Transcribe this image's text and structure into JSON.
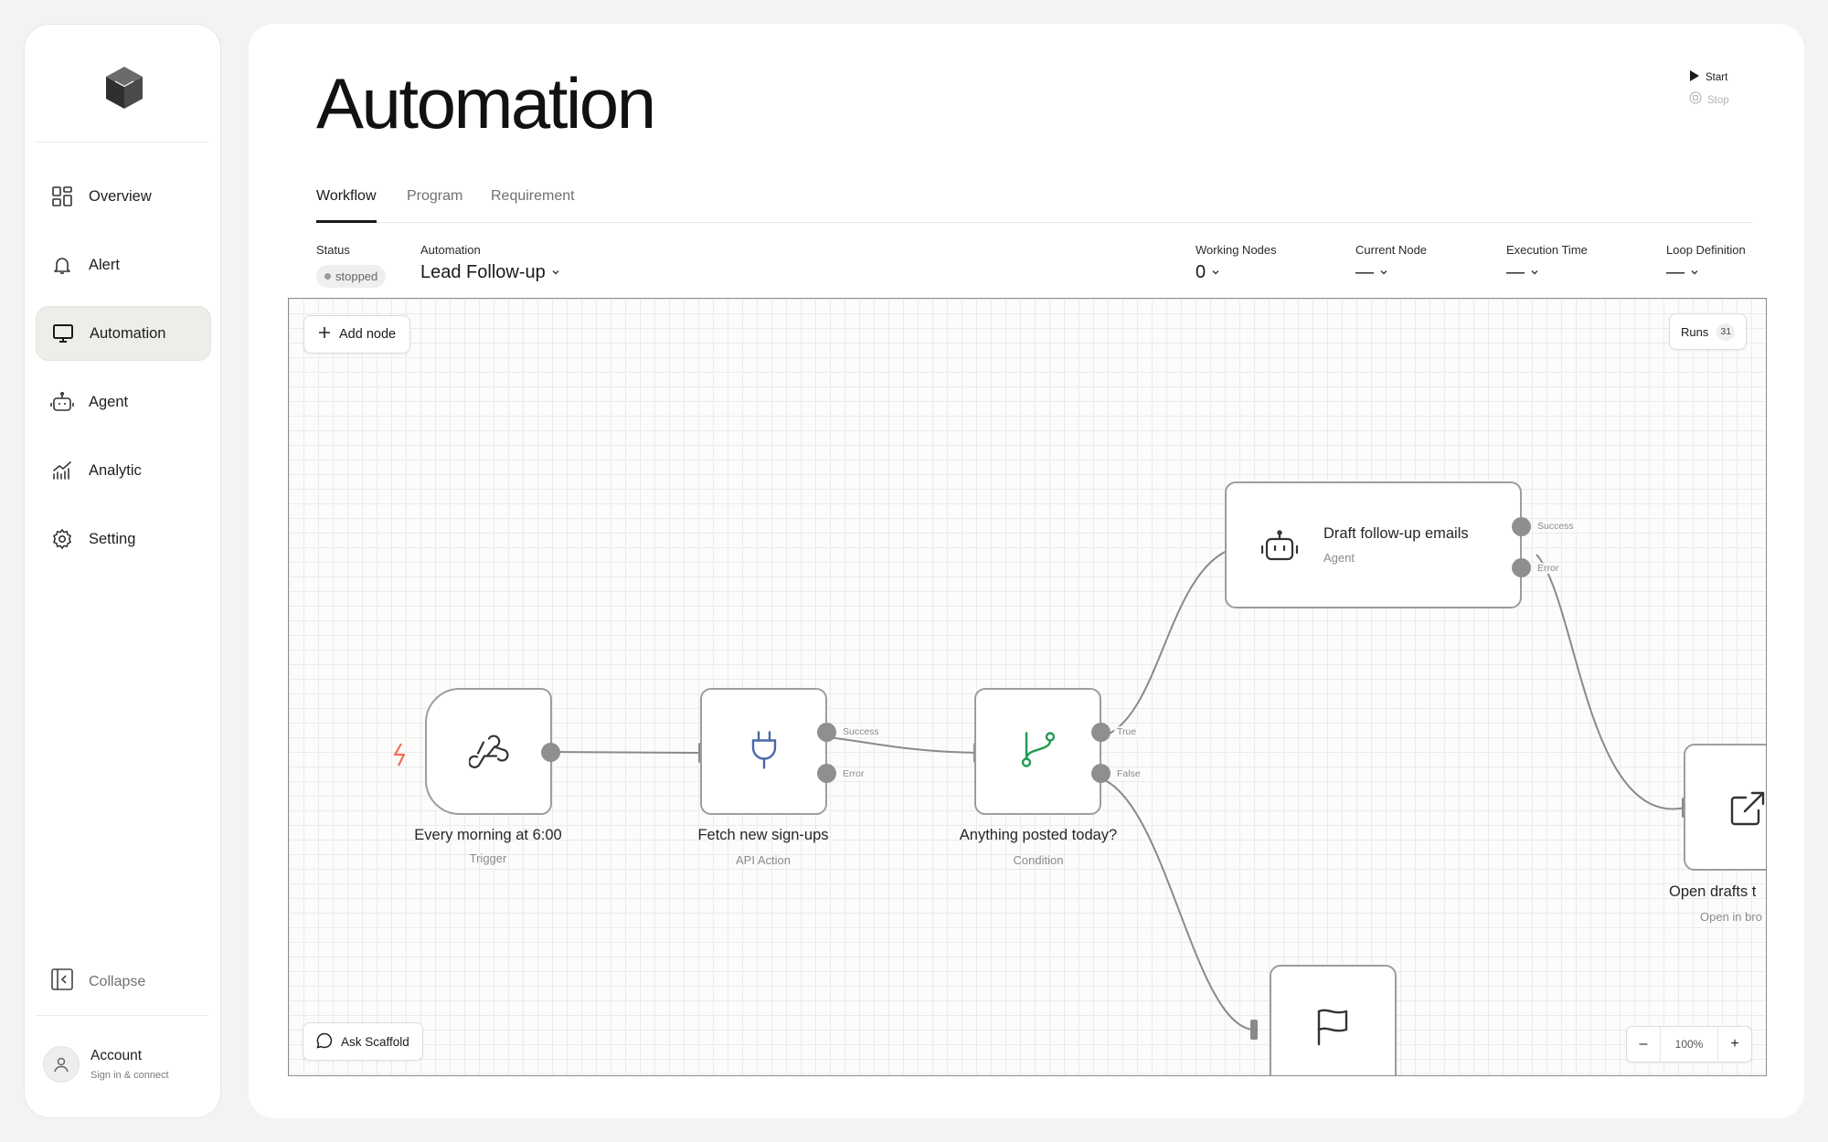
{
  "sidebar": {
    "items": [
      {
        "label": "Overview"
      },
      {
        "label": "Alert"
      },
      {
        "label": "Automation"
      },
      {
        "label": "Agent"
      },
      {
        "label": "Analytic"
      },
      {
        "label": "Setting"
      }
    ],
    "collapse_label": "Collapse",
    "account": {
      "name": "Account",
      "subtitle": "Sign in & connect"
    }
  },
  "header": {
    "title": "Automation",
    "start_label": "Start",
    "stop_label": "Stop"
  },
  "tabs": [
    {
      "label": "Workflow",
      "active": true
    },
    {
      "label": "Program",
      "active": false
    },
    {
      "label": "Requirement",
      "active": false
    }
  ],
  "meta": {
    "status_label": "Status",
    "status_value": "stopped",
    "automation_label": "Automation",
    "automation_value": "Lead Follow-up",
    "working_nodes_label": "Working Nodes",
    "working_nodes_value": "0",
    "current_node_label": "Current Node",
    "current_node_value": "—",
    "execution_time_label": "Execution Time",
    "execution_time_value": "—",
    "loop_definition_label": "Loop Definition",
    "loop_definition_value": "—"
  },
  "canvas": {
    "add_node_label": "Add node",
    "runs_label": "Runs",
    "runs_count": "31",
    "ask_label": "Ask Scaffold",
    "zoom_minus": "–",
    "zoom_value": "100%",
    "zoom_plus": "+",
    "nodes": [
      {
        "id": "trigger",
        "title": "Every morning at 6:00",
        "type": "Trigger",
        "icon": "webhook-icon"
      },
      {
        "id": "fetch",
        "title": "Fetch new sign-ups",
        "type": "API Action",
        "icon": "plug-icon",
        "outputs": [
          "Success",
          "Error"
        ]
      },
      {
        "id": "condition",
        "title": "Anything posted today?",
        "type": "Condition",
        "icon": "git-branch-icon",
        "outputs": [
          "True",
          "False"
        ]
      },
      {
        "id": "draft",
        "title": "Draft follow-up emails",
        "type": "Agent",
        "icon": "robot-icon",
        "outputs": [
          "Success",
          "Error"
        ]
      },
      {
        "id": "open",
        "title": "Open drafts t",
        "type": "Open in bro",
        "icon": "external-link-icon"
      },
      {
        "id": "flag",
        "icon": "flag-icon"
      }
    ]
  },
  "colors": {
    "trigger_bolt": "#f26a5a",
    "plug_icon": "#4a68a8",
    "branch_icon": "#1f9a4e",
    "nav_active_bg": "#eceee9"
  }
}
